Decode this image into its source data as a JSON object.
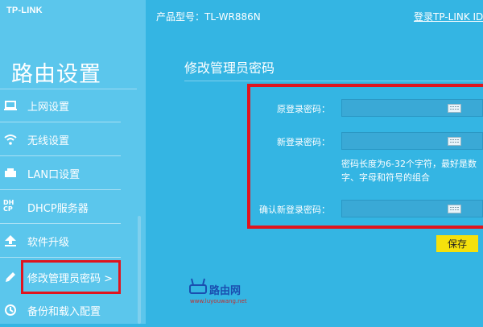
{
  "app": {
    "logo": "TP-LINK"
  },
  "header": {
    "model": "产品型号：TL-WR886N",
    "login": "登录TP-LINK ID"
  },
  "sidebar": {
    "title": "路由设置",
    "items": [
      {
        "label": "上网设置",
        "icon": "laptop-icon"
      },
      {
        "label": "无线设置",
        "icon": "wifi-icon"
      },
      {
        "label": "LAN口设置",
        "icon": "lan-icon"
      },
      {
        "label": "DHCP服务器",
        "icon": "dhcp-icon"
      },
      {
        "label": "软件升级",
        "icon": "upgrade-icon"
      },
      {
        "label": "修改管理员密码 >",
        "icon": "pencil-icon"
      },
      {
        "label": "备份和载入配置",
        "icon": "backup-icon"
      }
    ]
  },
  "main": {
    "title": "修改管理员密码",
    "fields": {
      "old_label": "原登录密码：",
      "new_label": "新登录密码：",
      "confirm_label": "确认新登录密码："
    },
    "hint": "密码长度为6-32个字符，最好是数字、字母和符号的组合",
    "save": "保存"
  },
  "watermark": {
    "name": "路由网",
    "url": "www.luyouwang.net"
  },
  "colors": {
    "background": "#34b5e3",
    "sidebar": "#5bc6ec",
    "highlight": "#e0141e",
    "save": "#f5e10c"
  }
}
